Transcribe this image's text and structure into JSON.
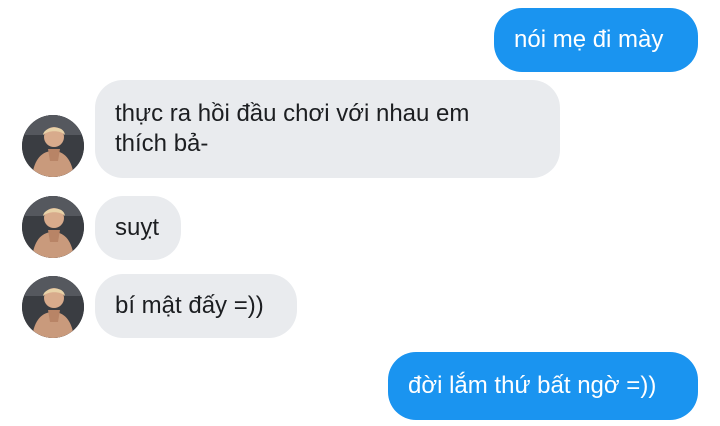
{
  "messages": [
    {
      "direction": "outgoing",
      "text": "nói mẹ đi mày"
    },
    {
      "direction": "incoming",
      "text": "thực ra hồi đầu chơi với nhau em thích bả-"
    },
    {
      "direction": "incoming",
      "text": "suỵt"
    },
    {
      "direction": "incoming",
      "text": "bí mật đấy =))"
    },
    {
      "direction": "outgoing",
      "text": "đời lắm thứ bất ngờ =))"
    }
  ],
  "colors": {
    "outgoing_bubble": "#1a94f0",
    "incoming_bubble": "#e9ebee",
    "outgoing_text": "#ffffff",
    "incoming_text": "#1c1e21"
  }
}
